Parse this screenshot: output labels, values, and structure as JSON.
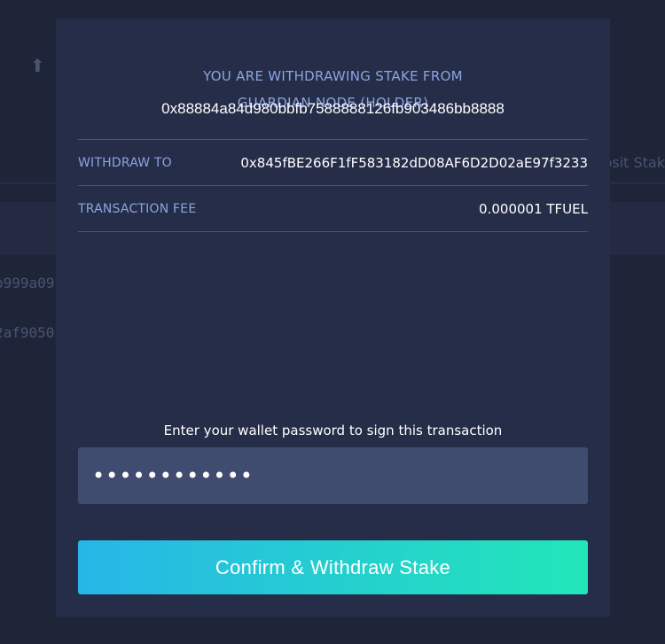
{
  "background": {
    "tab_fragment": "osit Stak",
    "row1_fragment": "o999a09",
    "row2_fragment": "2af9050"
  },
  "modal": {
    "heading_line1": "YOU ARE WITHDRAWING STAKE FROM",
    "heading_line2": "GUARDIAN NODE (HOLDER)",
    "holder_address": "0x88884a84d980bbfb7588888126fb903486bb8888",
    "details": [
      {
        "label": "WITHDRAW TO",
        "value": "0x845fBE266F1fF583182dD08AF6D2D02aE97f3233"
      },
      {
        "label": "TRANSACTION FEE",
        "value": "0.000001 TFUEL"
      }
    ],
    "password_label": "Enter your wallet password to sign this transaction",
    "password_value": "••••••••••••",
    "confirm_label": "Confirm & Withdraw Stake"
  },
  "colors": {
    "accent_start": "#27b6e8",
    "accent_end": "#22e6b8",
    "label": "#8da4de",
    "modal_bg": "#252d49"
  }
}
